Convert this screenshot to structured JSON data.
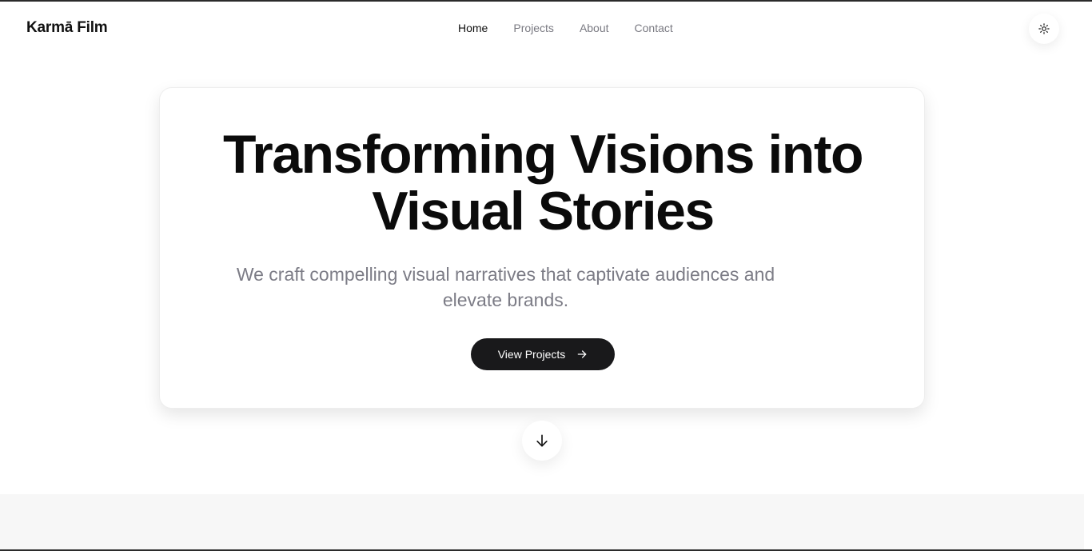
{
  "header": {
    "brand": "Karmā Film",
    "nav": [
      {
        "label": "Home",
        "active": true
      },
      {
        "label": "Projects",
        "active": false
      },
      {
        "label": "About",
        "active": false
      },
      {
        "label": "Contact",
        "active": false
      }
    ],
    "theme_toggle_icon": "sun-icon"
  },
  "hero": {
    "title_line1": "Transforming Visions into",
    "title_line2": "Visual Stories",
    "subtitle_line1": "We craft compelling visual narratives that captivate audiences and",
    "subtitle_line2": "elevate brands.",
    "cta_label": "View Projects",
    "cta_icon": "arrow-right-icon"
  },
  "scroll_indicator_icon": "arrow-down-icon",
  "colors": {
    "background": "#ffffff",
    "text_primary": "#0b0b0b",
    "text_muted": "#7c7c86",
    "cta_bg": "#19191b",
    "next_section_bg": "#f7f7f7"
  }
}
